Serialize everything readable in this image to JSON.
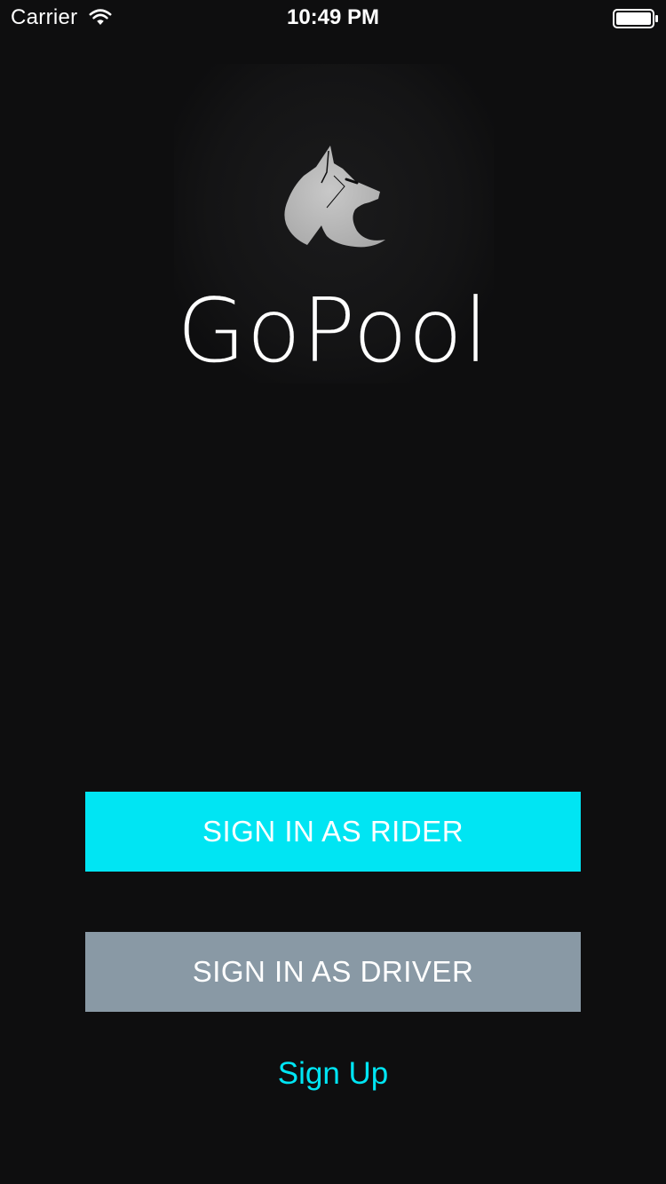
{
  "status_bar": {
    "carrier": "Carrier",
    "time": "10:49 PM",
    "wifi_icon": "wifi-icon",
    "battery_icon": "battery-full-icon"
  },
  "logo": {
    "icon": "wolf-logo-icon",
    "app_name": "GoPool"
  },
  "actions": {
    "rider_label": "SIGN IN AS RIDER",
    "driver_label": "SIGN IN AS DRIVER",
    "signup_label": "Sign Up"
  },
  "colors": {
    "background": "#0e0e0f",
    "accent": "#00e5f3",
    "driver_button": "#8999a5",
    "text": "#ffffff",
    "logo_gray": "#b9b9b9"
  }
}
